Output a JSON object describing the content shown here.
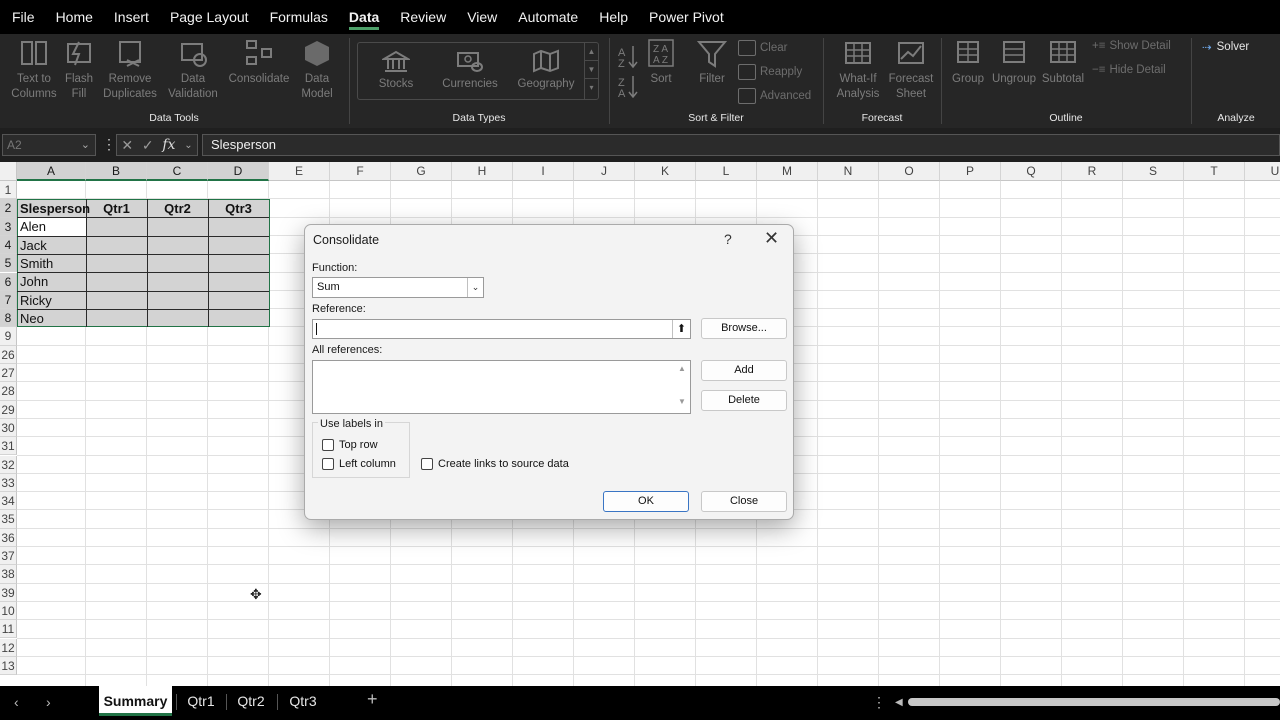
{
  "menu": [
    "File",
    "Home",
    "Insert",
    "Page Layout",
    "Formulas",
    "Data",
    "Review",
    "View",
    "Automate",
    "Help",
    "Power Pivot"
  ],
  "menu_active": "Data",
  "ribbon": {
    "data_tools": {
      "label": "Data Tools",
      "text_to_columns": "Text to Columns",
      "flash_fill": "Flash Fill",
      "remove_duplicates": "Remove Duplicates",
      "data_validation": "Data Validation",
      "consolidate": "Consolidate",
      "data_model": "Data Model"
    },
    "data_types": {
      "label": "Data Types",
      "stocks": "Stocks",
      "currencies": "Currencies",
      "geography": "Geography"
    },
    "sort_filter": {
      "label": "Sort & Filter",
      "sort": "Sort",
      "filter": "Filter",
      "clear": "Clear",
      "reapply": "Reapply",
      "advanced": "Advanced"
    },
    "forecast": {
      "label": "Forecast",
      "what_if": "What-If Analysis",
      "forecast_sheet": "Forecast Sheet"
    },
    "outline": {
      "label": "Outline",
      "group": "Group",
      "ungroup": "Ungroup",
      "subtotal": "Subtotal",
      "show_detail": "Show Detail",
      "hide_detail": "Hide Detail"
    },
    "analyze": {
      "label": "Analyze",
      "solver": "Solver"
    }
  },
  "formula_bar": {
    "name_box": "A2",
    "value": "Slesperson"
  },
  "columns": [
    "A",
    "B",
    "C",
    "D",
    "E",
    "F",
    "G",
    "H",
    "I",
    "J",
    "K",
    "L",
    "M",
    "N",
    "O",
    "P",
    "Q",
    "R",
    "S",
    "T",
    "U"
  ],
  "rows": [
    "1",
    "2",
    "3",
    "4",
    "5",
    "6",
    "7",
    "8",
    "9",
    "26",
    "27",
    "28",
    "29",
    "30",
    "31",
    "32",
    "33",
    "34",
    "35",
    "36",
    "37",
    "38",
    "39",
    "10",
    "11",
    "12",
    "13"
  ],
  "table": {
    "headers": [
      "Slesperson",
      "Qtr1",
      "Qtr2",
      "Qtr3"
    ],
    "names": [
      "Alen",
      "Jack",
      "Smith",
      "John",
      "Ricky",
      "Neo"
    ]
  },
  "sheets": [
    "Summary",
    "Qtr1",
    "Qtr2",
    "Qtr3"
  ],
  "active_sheet": "Summary",
  "dialog": {
    "title": "Consolidate",
    "help": "?",
    "close_x": "✕",
    "function_label": "Function:",
    "function_value": "Sum",
    "reference_label": "Reference:",
    "reference_value": "",
    "all_references_label": "All references:",
    "browse": "Browse...",
    "add": "Add",
    "delete": "Delete",
    "use_labels_in": "Use labels in",
    "top_row": "Top row",
    "left_column": "Left column",
    "create_links": "Create links to source data",
    "ok": "OK",
    "close": "Close"
  },
  "colors": {
    "accent_green": "#217346",
    "selection_gray": "#d3d3d3",
    "ribbon_bg": "#262626"
  }
}
